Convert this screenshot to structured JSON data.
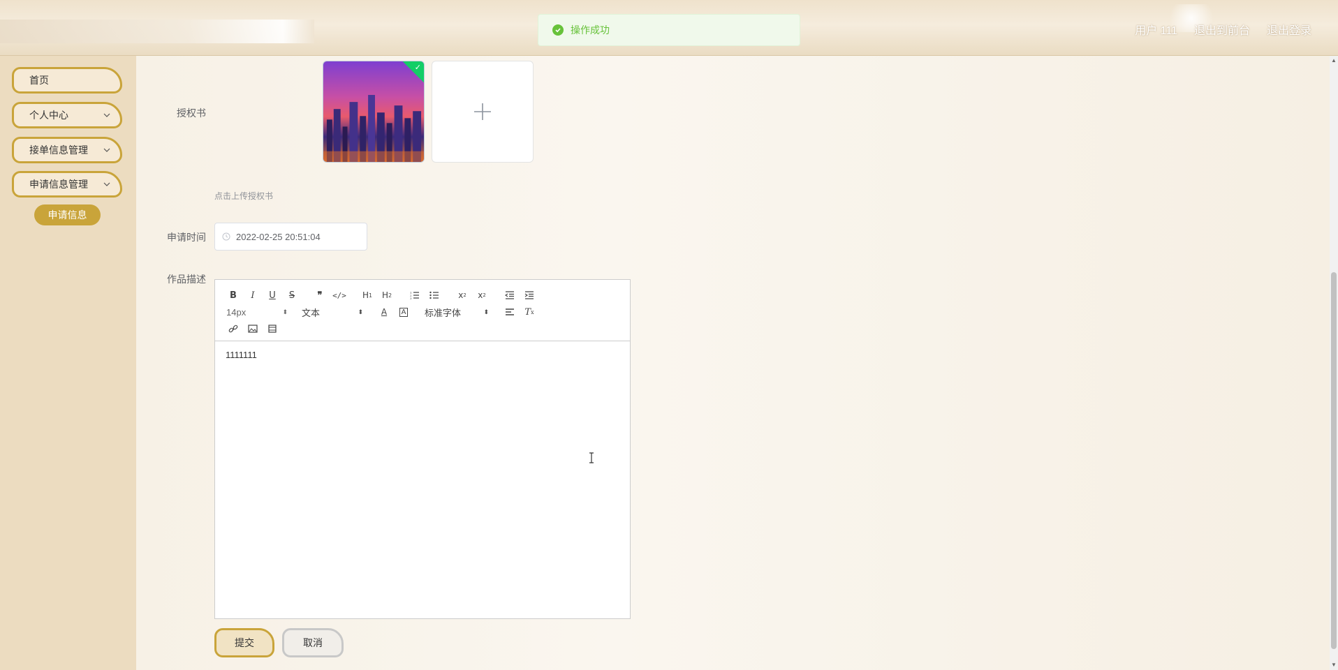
{
  "header": {
    "user_label": "用户 111",
    "front_link": "退出到前台",
    "logout_link": "退出登录"
  },
  "toast": {
    "message": "操作成功",
    "icon": "check-circle-icon",
    "color": "#67c23a"
  },
  "sidebar": {
    "items": [
      {
        "label": "首页",
        "has_children": false
      },
      {
        "label": "个人中心",
        "has_children": true
      },
      {
        "label": "接单信息管理",
        "has_children": true
      },
      {
        "label": "申请信息管理",
        "has_children": true
      }
    ],
    "active_sub_item": "申请信息",
    "accent_color": "#c9a43a"
  },
  "form": {
    "authorization_label": "授权书",
    "upload_tip": "点击上传授权书",
    "apply_time_label": "申请时间",
    "apply_time_value": "2022-02-25 20:51:04",
    "description_label": "作品描述",
    "editor": {
      "font_size": "14px",
      "text_style": "文本",
      "font_family": "标准字体",
      "content": "1111111"
    },
    "submit_label": "提交",
    "cancel_label": "取消"
  }
}
